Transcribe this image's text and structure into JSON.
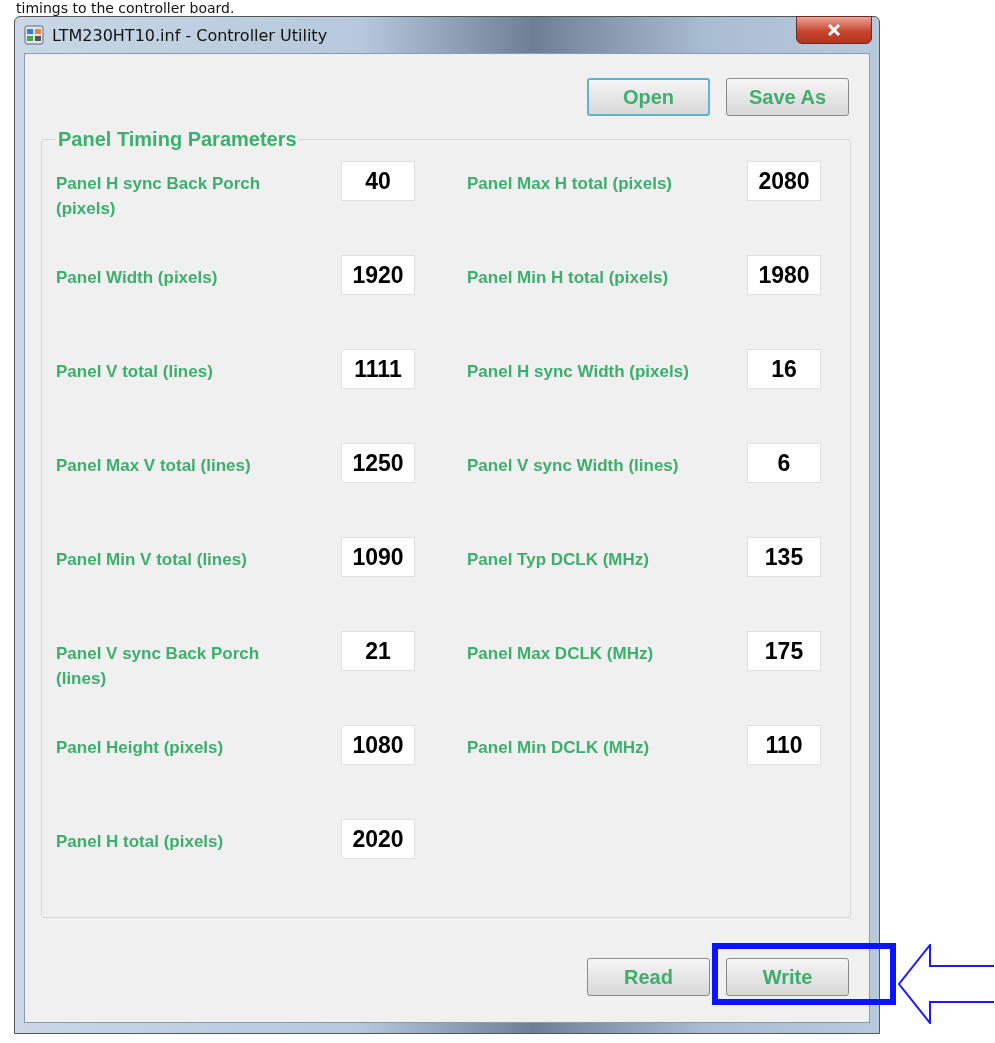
{
  "caption": "timings to the controller board.",
  "window": {
    "title": "LTM230HT10.inf - Controller Utility"
  },
  "top_buttons": [
    "Open",
    "Save As"
  ],
  "group": {
    "title": "Panel Timing Parameters",
    "left_column": [
      {
        "label": "Panel H sync Back Porch (pixels)",
        "value": "40"
      },
      {
        "label": "Panel Width (pixels)",
        "value": "1920"
      },
      {
        "label": "Panel V total (lines)",
        "value": "1111"
      },
      {
        "label": "Panel Max V total (lines)",
        "value": "1250"
      },
      {
        "label": "Panel Min V total (lines)",
        "value": "1090"
      },
      {
        "label": "Panel V sync Back Porch (lines)",
        "value": "21"
      },
      {
        "label": "Panel Height (pixels)",
        "value": "1080"
      },
      {
        "label": "Panel H total (pixels)",
        "value": "2020"
      }
    ],
    "right_column": [
      {
        "label": "Panel Max H total (pixels)",
        "value": "2080"
      },
      {
        "label": "Panel Min H total (pixels)",
        "value": "1980"
      },
      {
        "label": "Panel H sync Width (pixels)",
        "value": "16"
      },
      {
        "label": "Panel V sync Width (lines)",
        "value": "6"
      },
      {
        "label": "Panel Typ DCLK (MHz)",
        "value": "135"
      },
      {
        "label": "Panel Max DCLK (MHz)",
        "value": "175"
      },
      {
        "label": "Panel Min DCLK (MHz)",
        "value": "110"
      }
    ]
  },
  "bottom_buttons": [
    {
      "label": "Read",
      "kind": "plain"
    },
    {
      "label": "Write",
      "kind": "highlighted"
    }
  ]
}
